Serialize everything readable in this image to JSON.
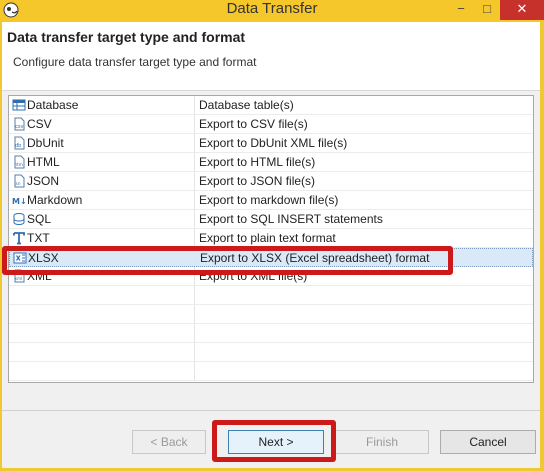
{
  "window": {
    "title": "Data Transfer",
    "minimize_glyph": "−",
    "maximize_glyph": "□",
    "close_glyph": "✕"
  },
  "header": {
    "title": "Data transfer target type and format",
    "subtitle": "Configure data transfer target type and format"
  },
  "formats": [
    {
      "name": "Database",
      "description": "Database table(s)",
      "icon": "database-icon"
    },
    {
      "name": "CSV",
      "description": "Export to CSV file(s)",
      "icon": "csv-icon"
    },
    {
      "name": "DbUnit",
      "description": "Export to DbUnit XML file(s)",
      "icon": "dbunit-icon"
    },
    {
      "name": "HTML",
      "description": "Export to HTML file(s)",
      "icon": "html-icon"
    },
    {
      "name": "JSON",
      "description": "Export to JSON file(s)",
      "icon": "json-icon"
    },
    {
      "name": "Markdown",
      "description": "Export to markdown file(s)",
      "icon": "markdown-icon"
    },
    {
      "name": "SQL",
      "description": "Export to SQL INSERT statements",
      "icon": "sql-icon"
    },
    {
      "name": "TXT",
      "description": "Export to plain text format",
      "icon": "txt-icon"
    },
    {
      "name": "XLSX",
      "description": "Export to XLSX (Excel spreadsheet) format",
      "icon": "xlsx-icon"
    },
    {
      "name": "XML",
      "description": "Export to XML file(s)",
      "icon": "xml-icon"
    }
  ],
  "selected_format": "XLSX",
  "buttons": {
    "back": "< Back",
    "next": "Next >",
    "finish": "Finish",
    "cancel": "Cancel"
  },
  "colors": {
    "title_bar": "#f5c72a",
    "close_button": "#c7312b",
    "selection": "#d9e9f8",
    "annotation": "#cc1a1a"
  }
}
